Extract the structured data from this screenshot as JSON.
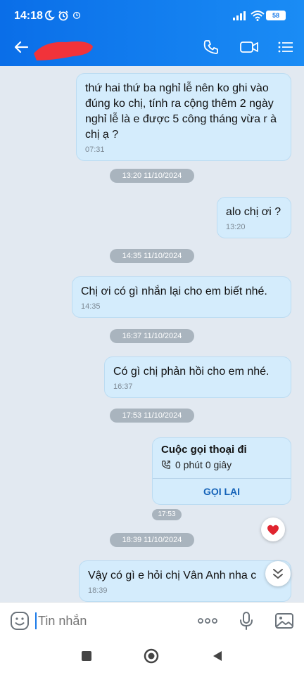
{
  "status_bar": {
    "time": "14:18",
    "battery": "58"
  },
  "header": {
    "contact_name_redacted": true
  },
  "messages": [
    {
      "text": "thứ hai thứ ba nghỉ lễ nên ko ghi vào đúng ko chị, tính ra cộng thêm 2 ngày nghỉ lễ là e được 5 công tháng vừa r à chị ạ ?",
      "time": "07:31"
    },
    {
      "text": "alo chị ơi ?",
      "time": "13:20"
    },
    {
      "text": "Chị ơi có gì nhắn lại cho em biết nhé.",
      "time": "14:35"
    },
    {
      "text": "Có gì chị phản hồi cho em nhé.",
      "time": "16:37"
    },
    {
      "text": "Vậy có gì e hỏi chị Vân Anh nha c",
      "time": "18:39"
    }
  ],
  "date_separators": [
    "13:20 11/10/2024",
    "14:35 11/10/2024",
    "16:37 11/10/2024",
    "17:53 11/10/2024",
    "18:39 11/10/2024"
  ],
  "call_card": {
    "title": "Cuộc gọi thoại đi",
    "duration": "0 phút 0 giây",
    "action": "GỌI LẠI",
    "time": "17:53"
  },
  "composer": {
    "placeholder": "Tin nhắn"
  }
}
